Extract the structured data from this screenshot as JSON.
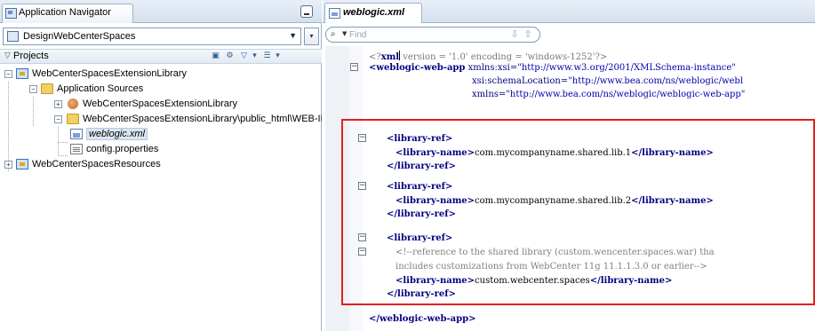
{
  "navigator": {
    "tab_label": "Application Navigator",
    "app_selector": "DesignWebCenterSpaces",
    "projects_label": "Projects",
    "tree": [
      {
        "label": "WebCenterSpacesExtensionLibrary",
        "icon": "project-icon",
        "expander": "−"
      },
      {
        "label": "Application Sources",
        "icon": "folder-icon",
        "expander": "−"
      },
      {
        "label": "WebCenterSpacesExtensionLibrary",
        "icon": "package-icon",
        "expander": "+"
      },
      {
        "label": "WebCenterSpacesExtensionLibrary\\public_html\\WEB-INF",
        "icon": "folder-icon",
        "expander": "−"
      },
      {
        "label": "weblogic.xml",
        "icon": "xml-file-icon",
        "expander": ""
      },
      {
        "label": "config.properties",
        "icon": "properties-file-icon",
        "expander": ""
      },
      {
        "label": "WebCenterSpacesResources",
        "icon": "project-icon",
        "expander": "+"
      }
    ]
  },
  "editor": {
    "tab_label": "weblogic.xml",
    "find_placeholder": "Find",
    "lines": {
      "l1_pi_open": "<?",
      "l1_xml": "xml",
      "l1_rest": " version = '1.0' encoding = 'windows-1252'?>",
      "l2_tag": "<weblogic-web-app",
      "l2_attr": " xmlns:xsi=",
      "l2_val": "\"http://www.w3.org/2001/XMLSchema-instance\"",
      "l3_attr": "xsi:schemaLocation=",
      "l3_val": "\"http://www.bea.com/ns/weblogic/webl",
      "l4_attr": "xmlns=",
      "l4_val": "\"http://www.bea.com/ns/weblogic/weblogic-web-app\"",
      "library_ref_open": "<library-ref>",
      "library_ref_close": "</library-ref>",
      "library_name_open": "<library-name>",
      "library_name_close": "</library-name>",
      "lib1_value": "com.mycompanyname.shared.lib.1",
      "lib2_value": "com.mycompanyname.shared.lib.2",
      "comment_line1": "<!--reference to the shared library (custom.wencenter.spaces.war) tha",
      "comment_line2": "includes customizations from WebCenter 11g 11.1.1.3.0 or earlier-->",
      "lib3_value": "custom.webcenter.spaces",
      "closing_tag": "</weblogic-web-app>"
    }
  },
  "colors": {
    "highlight_border": "#e0201e",
    "tag_color": "#000080",
    "comment_color": "#808080"
  }
}
